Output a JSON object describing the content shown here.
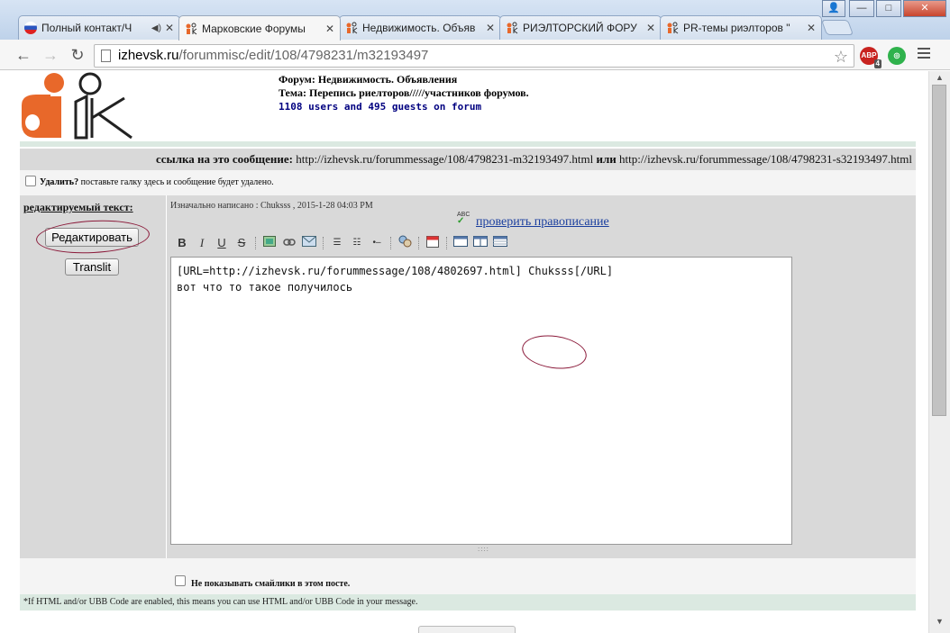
{
  "tabs": [
    {
      "title": "Полный контакт/Ч",
      "favicon": "russia-flag-icon"
    },
    {
      "title": "Марковские Форумы",
      "favicon": "ik-logo-icon"
    },
    {
      "title": "Недвижимость. Объяв",
      "favicon": "ik-logo-icon"
    },
    {
      "title": "РИЭЛТОРСКИЙ ФОРУ",
      "favicon": "ik-logo-icon"
    },
    {
      "title": "PR-темы риэлторов \"",
      "favicon": "ik-logo-icon"
    }
  ],
  "address": {
    "host": "izhevsk.ru",
    "path": "/forummisc/edit/108/4798231/m32193497"
  },
  "extensions": {
    "abp_badge": "4",
    "abp_label": "ABP"
  },
  "header": {
    "forum_label": "Форум:",
    "forum_value": "Недвижимость. Объявления",
    "topic_label": "Тема:",
    "topic_value": "Перепись риелторов/////участников форумов.",
    "users_line": "1108 users and 495 guests on forum"
  },
  "link_row": {
    "label": "ссылка на это сообщение:",
    "url1": "http://izhevsk.ru/forummessage/108/4798231-m32193497.html",
    "or": "или",
    "url2": "http://izhevsk.ru/forummessage/108/4798231-s32193497.html"
  },
  "delete_row": {
    "label": "Удалить?",
    "hint": "поставьте галку здесь и сообщение будет удалено."
  },
  "left": {
    "edit_label": "редактируемый текст:",
    "edit_button": "Редактировать",
    "translit_button": "Translit"
  },
  "editor": {
    "original": "Изначально написано : Chuksss , 2015-1-28 04:03 PM",
    "spellcheck": "проверить правописание",
    "spell_icon_text": "ABC",
    "text_line1": "[URL=http://izhevsk.ru/forummessage/108/4802697.html] Chuksss[/URL]",
    "text_line2": "",
    "text_line3": "вот что то такое получилось"
  },
  "toolbar_icons": [
    "bold-icon",
    "italic-icon",
    "underline-icon",
    "strike-icon",
    "image-icon",
    "link-icon",
    "email-icon",
    "ordered-list-icon",
    "unordered-list-icon",
    "hr-icon",
    "user-icon",
    "calendar-icon",
    "window-icon",
    "columns-icon",
    "table-icon"
  ],
  "lower": {
    "no_smiles": "Не показывать смайлики в этом посте."
  },
  "note": "*If HTML and/or UBB Code are enabled, this means you can use HTML and/or UBB Code in your message.",
  "colors": {
    "annotation": "#8b1a3a",
    "link": "#1a3e9e",
    "users": "#000080"
  }
}
